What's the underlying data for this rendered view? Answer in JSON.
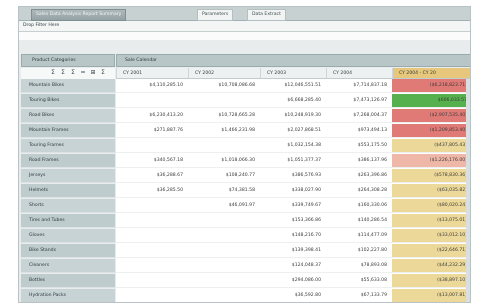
{
  "tabs": [
    {
      "label": "Sales Data Analysis Report Summary",
      "active": true
    },
    {
      "label": "Parameters",
      "active": false
    },
    {
      "label": "Data Extract",
      "active": false
    }
  ],
  "toolbar": {
    "label": "Drop Filter Here"
  },
  "row_header_title": "Product Categories",
  "column_header_title": "Sale Calendar",
  "header_icons": [
    "Σ",
    "Σ",
    "Σ",
    "=",
    "⊞",
    "Σ"
  ],
  "years": [
    "CY 2001",
    "CY 2002",
    "CY 2003",
    "CY 2004",
    "CY 2004 - CY 20"
  ],
  "rows": [
    {
      "label": "Mountain Bikes",
      "values": [
        "$4,110,285.10",
        "$10,708,086.68",
        "$12,046,551.51",
        "$7,714,837.18",
        "($6,218,823.71)"
      ]
    },
    {
      "label": "Touring Bikes",
      "values": [
        "",
        "",
        "$6,668,285.40",
        "$7,473,126.97",
        "$606,033.57"
      ]
    },
    {
      "label": "Road Bikes",
      "values": [
        "$6,230,413.20",
        "$10,728,665.28",
        "$10,248,919.30",
        "$7,268,004.37",
        "($2,907,535.40)"
      ]
    },
    {
      "label": "Mountain Frames",
      "values": [
        "$271,887.76",
        "$1,466,231.98",
        "$2,027,868.51",
        "$973,494.13",
        "($1,209,853.40)"
      ]
    },
    {
      "label": "Touring Frames",
      "values": [
        "",
        "",
        "$1,032,154.38",
        "$553,175.50",
        "($437,805.43)"
      ]
    },
    {
      "label": "Road Frames",
      "values": [
        "$340,567.18",
        "$1,018,066.30",
        "$1,051,377.37",
        "$386,137.96",
        "($1,226,176.00)"
      ]
    },
    {
      "label": "Jerseys",
      "values": [
        "$36,288.67",
        "$108,240.77",
        "$386,576.93",
        "$263,396.86",
        "($578,830.36)"
      ]
    },
    {
      "label": "Helmets",
      "values": [
        "$36,285.50",
        "$74,381.58",
        "$338,027.90",
        "$264,308.28",
        "($63,035.82)"
      ]
    },
    {
      "label": "Shorts",
      "values": [
        "",
        "$46,091.97",
        "$339,749.67",
        "$160,330.06",
        "($80,020.24)"
      ]
    },
    {
      "label": "Tires and Tubes",
      "values": [
        "",
        "",
        "$153,366.86",
        "$140,286.54",
        "($13,075.01)"
      ]
    },
    {
      "label": "Gloves",
      "values": [
        "",
        "",
        "$148,216.70",
        "$114,477.09",
        "($33,012.10)"
      ]
    },
    {
      "label": "Bike Stands",
      "values": [
        "",
        "",
        "$139,398.41",
        "$102,227.80",
        "($22,646.71)"
      ]
    },
    {
      "label": "Cleaners",
      "values": [
        "",
        "",
        "$124,048.37",
        "$78,893.08",
        "($44,232.29)"
      ]
    },
    {
      "label": "Bottles",
      "values": [
        "",
        "",
        "$294,086.00",
        "$55,633.08",
        "($38,897.10)"
      ]
    },
    {
      "label": "Hydration Packs",
      "values": [
        "",
        "",
        "$36,592.80",
        "$67,133.79",
        "($13,007.81)"
      ]
    }
  ],
  "colors": {
    "variance_negative_strong": "#e07a76",
    "variance_negative_light": "#efb7a8",
    "variance_positive": "#55b04d",
    "variance_neutral": "#ecd99a",
    "header_gold": "#e6c77b"
  }
}
